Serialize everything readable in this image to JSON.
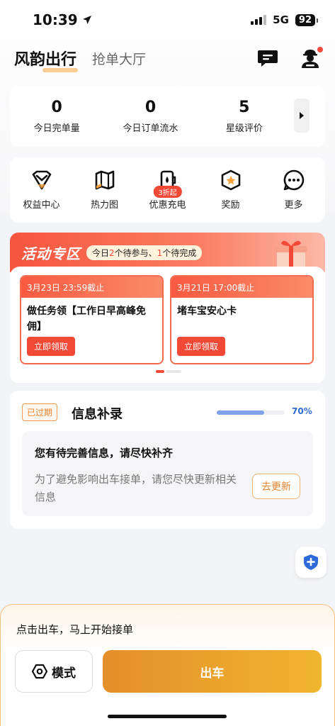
{
  "status_bar": {
    "time": "10:39",
    "network": "5G",
    "battery": "92"
  },
  "header": {
    "active_tab": "风韵出行",
    "other_tab": "抢单大厅"
  },
  "stats": [
    {
      "value": "0",
      "label": "今日完单量"
    },
    {
      "value": "0",
      "label": "今日订单流水"
    },
    {
      "value": "5",
      "label": "星级评价"
    }
  ],
  "menu": [
    {
      "label": "权益中心",
      "icon": "crown-shield-icon"
    },
    {
      "label": "热力图",
      "icon": "map-icon"
    },
    {
      "label": "优惠充电",
      "icon": "charging-icon",
      "badge": "3折起"
    },
    {
      "label": "奖励",
      "icon": "star-badge-icon"
    },
    {
      "label": "更多",
      "icon": "more-dots-icon"
    }
  ],
  "activity": {
    "title": "活动专区",
    "summary_prefix": "今日",
    "pending_join": "2",
    "summary_mid": "个待参与、",
    "pending_done": "1",
    "summary_suffix": "个待完成",
    "tasks": [
      {
        "deadline": "3月23日 23:59截止",
        "name": "做任务领【工作日早高峰免佣】",
        "button": "立即领取"
      },
      {
        "deadline": "3月21日 17:00截止",
        "name": "堵车宝安心卡",
        "button": "立即领取"
      }
    ]
  },
  "info": {
    "status": "已过期",
    "title": "信息补录",
    "progress": 0.7,
    "progress_label": "70%",
    "box_title": "您有待完善信息，请尽快补齐",
    "box_desc": "为了避免影响出车接单，请您尽快更新相关信息",
    "update_button": "去更新"
  },
  "bottom": {
    "hint": "点击出车，马上开始接单",
    "mode_label": "模式",
    "go_label": "出车"
  },
  "colors": {
    "accent_orange": "#f1b52e",
    "red": "#f24937",
    "blue": "#2f6bd8"
  }
}
